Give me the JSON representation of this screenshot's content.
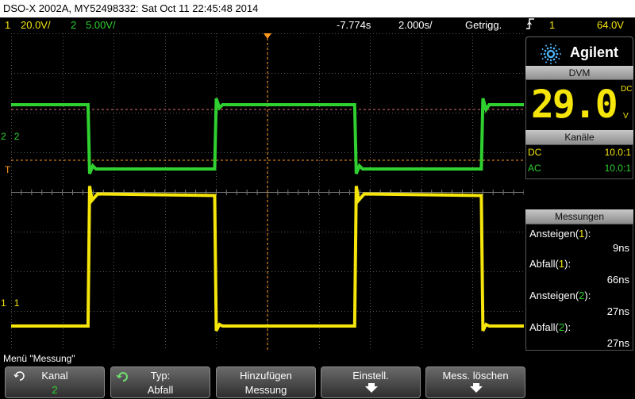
{
  "title_bar": "DSO-X 2002A, MY52498332: Sat Oct 11 22:45:48 2014",
  "status": {
    "ch1_num": "1",
    "ch1_scale": "20.0V/",
    "ch2_num": "2",
    "ch2_scale": "5.00V/",
    "h_delay": "-7.774s",
    "time_scale": "2.000s/",
    "trigger_mode": "Getrigg.",
    "trigger_edge_icon": "rising-edge-icon",
    "trigger_source": "1",
    "trigger_level": "64.0V"
  },
  "markers": {
    "ch1_label": "1",
    "ch2_label": "2",
    "trigger_label": "T"
  },
  "brand": "Agilent",
  "dvm": {
    "header": "DVM",
    "value": "29.0",
    "mode": "DC",
    "unit": "V"
  },
  "kanale": {
    "header": "Kanäle",
    "rows": [
      {
        "coupling": "DC",
        "probe": "10.0:1"
      },
      {
        "coupling": "AC",
        "probe": "10.0:1"
      }
    ]
  },
  "messungen": {
    "header": "Messungen",
    "items": [
      {
        "name": "Ansteigen",
        "channel": "1",
        "value": "9ns"
      },
      {
        "name": "Abfall",
        "channel": "1",
        "value": "66ns"
      },
      {
        "name": "Ansteigen",
        "channel": "2",
        "value": "27ns"
      },
      {
        "name": "Abfall",
        "channel": "2",
        "value": "27ns"
      }
    ]
  },
  "menu_title": "Menü \"Messung\"",
  "softkeys": [
    {
      "line1": "Kanal",
      "line2": "2"
    },
    {
      "line1": "Typ:",
      "line2": "Abfall"
    },
    {
      "line1": "Hinzufügen",
      "line2": "Messung"
    },
    {
      "line1": "Einstell.",
      "line2": ""
    },
    {
      "line1": "Mess. löschen",
      "line2": ""
    }
  ],
  "colors": {
    "ch1": "#f5e50a",
    "ch2": "#2fd02f",
    "trigger": "#ff9a1a",
    "grid": "#555555"
  },
  "waveforms": {
    "period_div": 5.2,
    "ch1_low_div": 7.38,
    "ch1_high_div": 4.05,
    "ch2_high_div": 1.8,
    "ch2_low_div": 3.42,
    "edges_div": [
      1.5,
      3.97,
      6.7,
      9.17
    ]
  }
}
